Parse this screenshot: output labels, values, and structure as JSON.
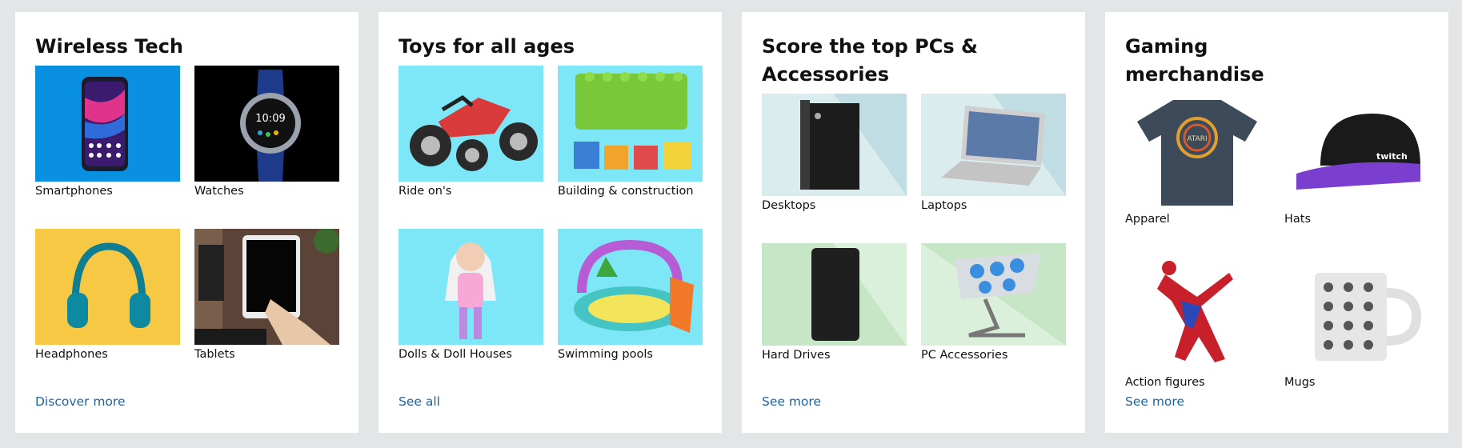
{
  "cards": [
    {
      "title": "Wireless Tech",
      "tiles": [
        {
          "label": "Smartphones",
          "icon": "smartphone-icon"
        },
        {
          "label": "Watches",
          "icon": "watch-icon",
          "screen_text": "10:09"
        },
        {
          "label": "Headphones",
          "icon": "headphones-icon"
        },
        {
          "label": "Tablets",
          "icon": "tablet-icon"
        }
      ],
      "cta": "Discover more"
    },
    {
      "title": "Toys for all ages",
      "tiles": [
        {
          "label": "Ride on's",
          "icon": "atv-icon"
        },
        {
          "label": "Building & construction",
          "icon": "building-blocks-icon"
        },
        {
          "label": "Dolls & Doll Houses",
          "icon": "doll-icon"
        },
        {
          "label": "Swimming pools",
          "icon": "pool-icon"
        }
      ],
      "cta": "See all"
    },
    {
      "title": "Score the top PCs & Accessories",
      "tiles": [
        {
          "label": "Desktops",
          "icon": "desktop-tower-icon"
        },
        {
          "label": "Laptops",
          "icon": "laptop-icon"
        },
        {
          "label": "Hard Drives",
          "icon": "hard-drive-icon"
        },
        {
          "label": "PC Accessories",
          "icon": "laptop-stand-icon"
        }
      ],
      "cta": "See more"
    },
    {
      "title": "Gaming merchandise",
      "tiles": [
        {
          "label": "Apparel",
          "icon": "tshirt-icon",
          "logo_text": "ATARI"
        },
        {
          "label": "Hats",
          "icon": "cap-icon",
          "logo_text": "twitch"
        },
        {
          "label": "Action figures",
          "icon": "action-figure-icon"
        },
        {
          "label": "Mugs",
          "icon": "mug-icon"
        }
      ],
      "cta": "See more"
    }
  ],
  "colors": {
    "page_bg": "#e3e6e6",
    "card_bg": "#ffffff",
    "link": "#2162a1",
    "toy_bg": "#7de6f7",
    "pc_bg_blue": "#dbecee",
    "pc_bg_green": "#c6e6c6"
  }
}
